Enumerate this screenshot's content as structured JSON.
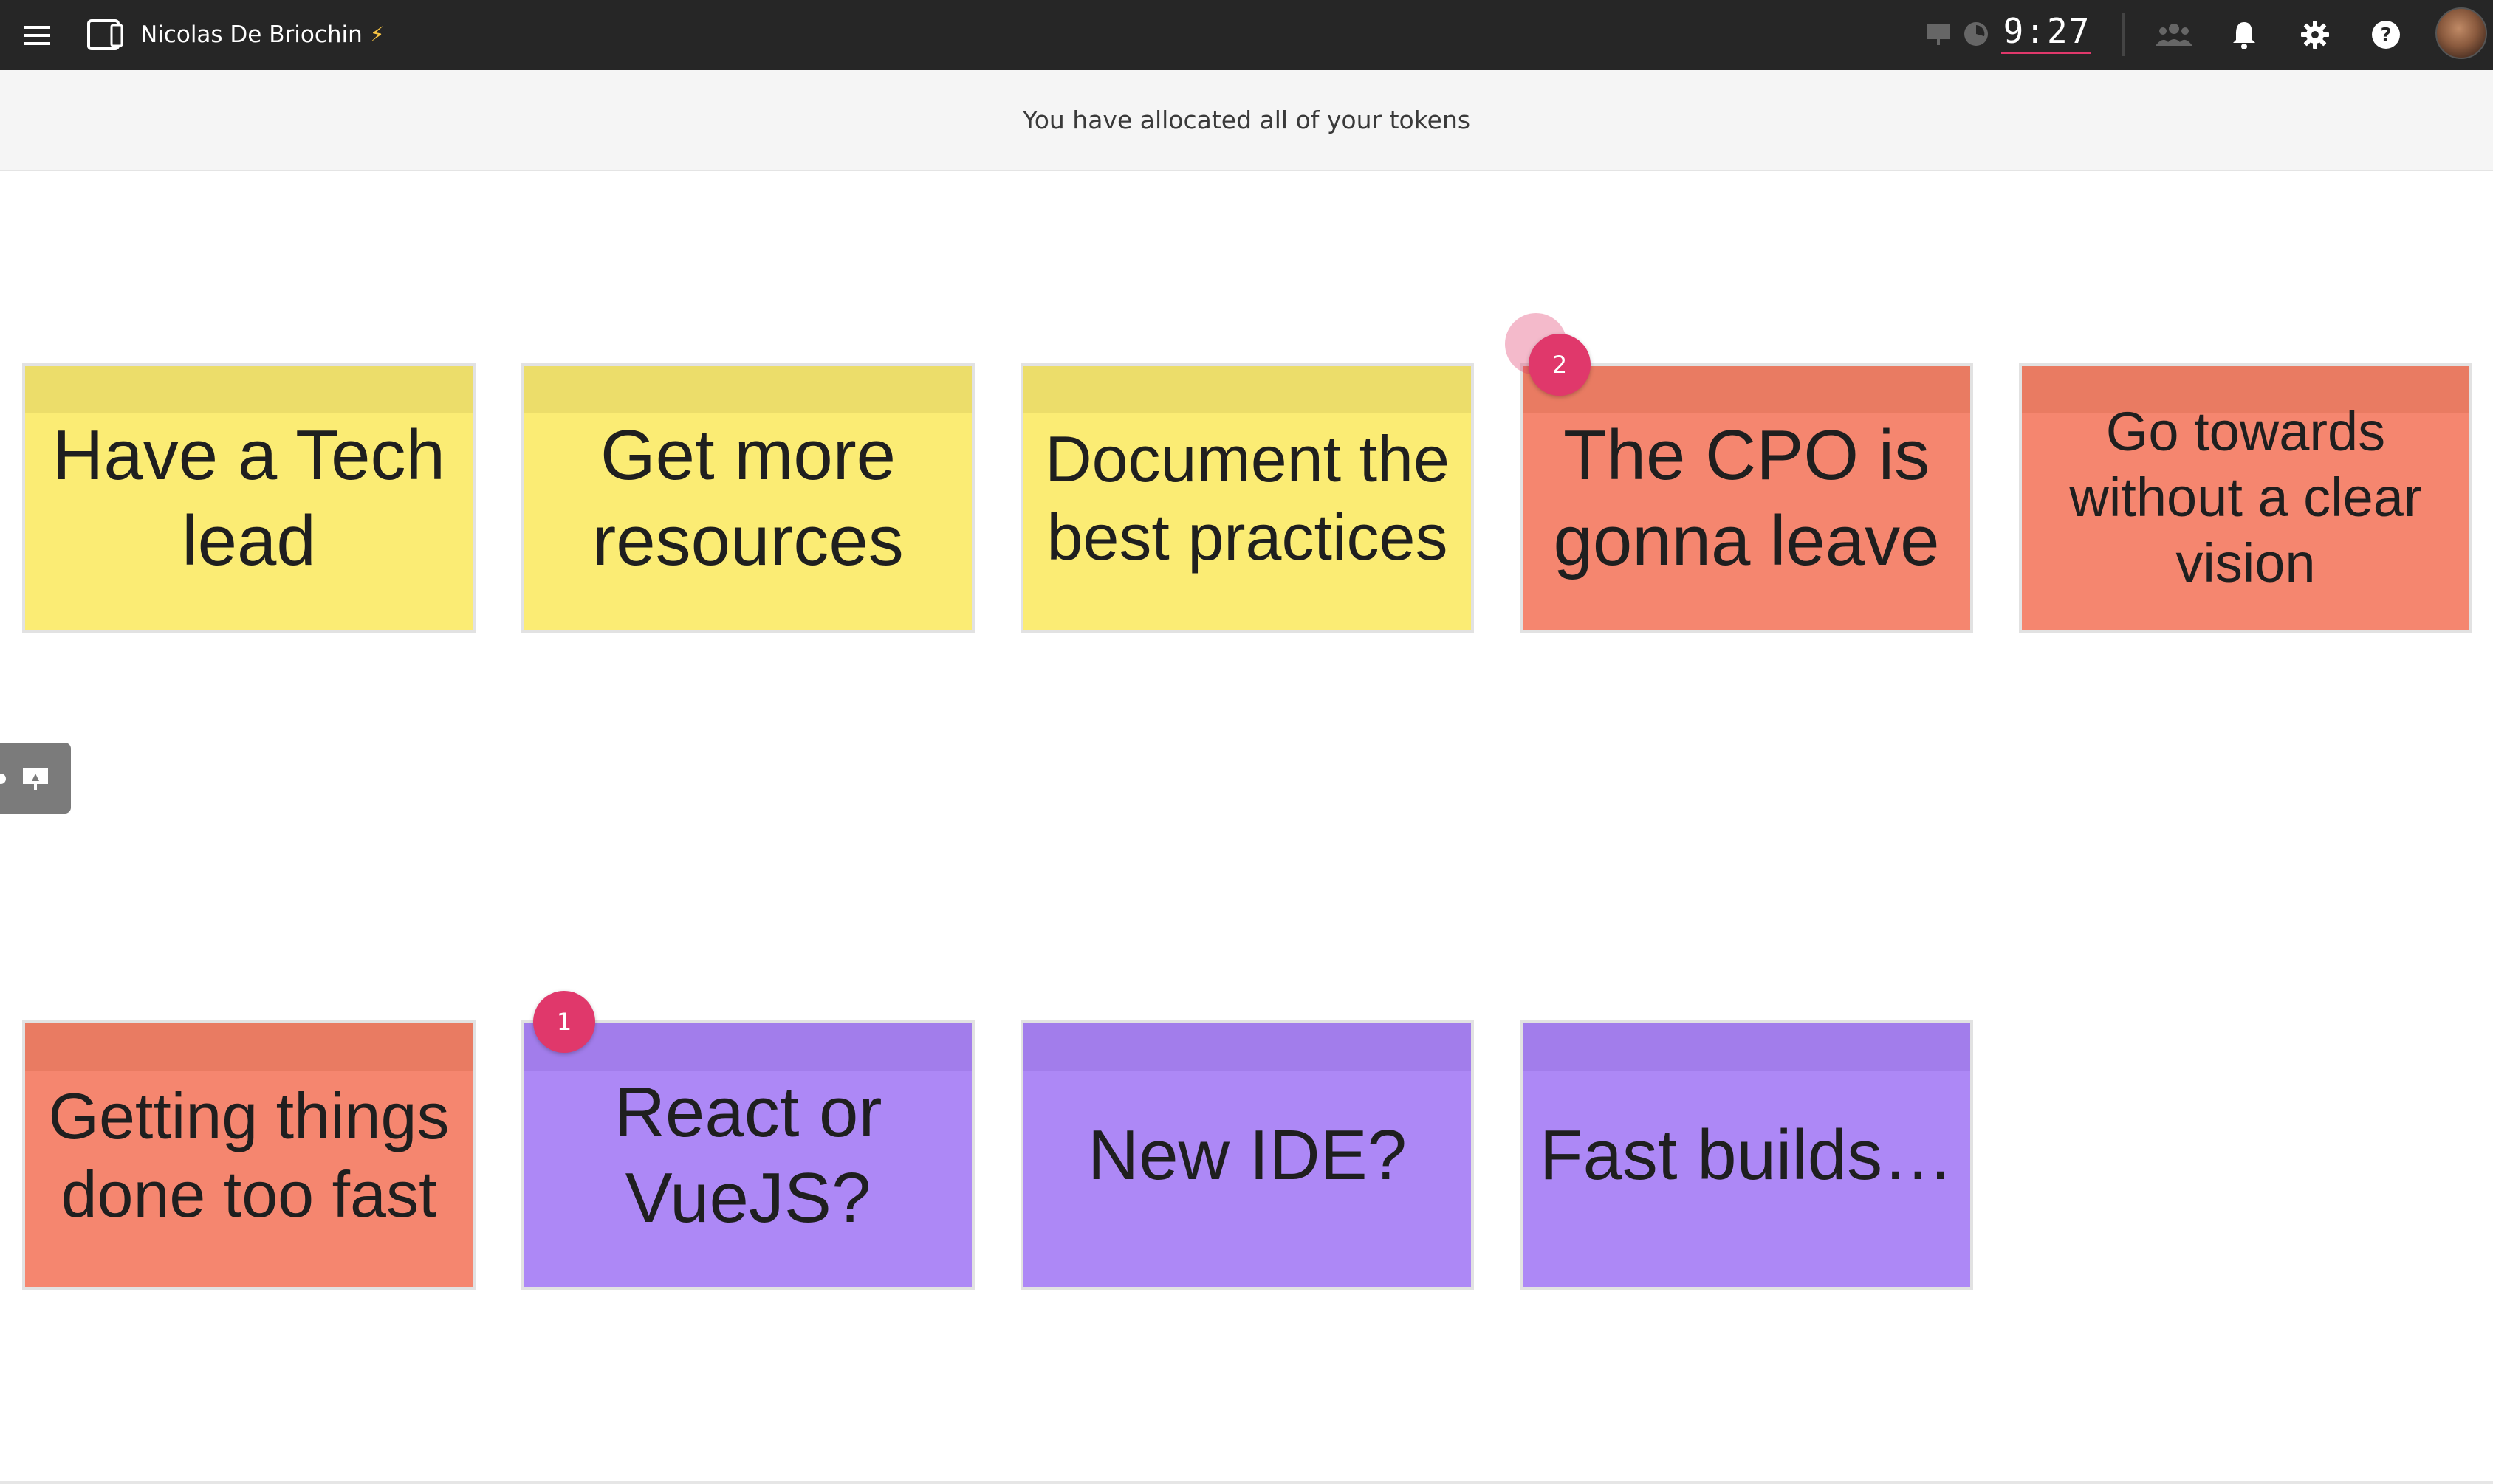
{
  "header": {
    "user_name": "Nicolas De Briochin",
    "bolt_icon": "lightning-bolt",
    "timer": "9:27",
    "icons": [
      "menu-icon",
      "tablet-icon",
      "presenter-icon",
      "clock-icon",
      "participants-icon",
      "bell-icon",
      "gear-icon",
      "help-icon"
    ]
  },
  "banner": {
    "message": "You have allocated all of your tokens"
  },
  "board": {
    "notes": [
      {
        "text": "Have a Tech lead",
        "color": "yellow",
        "votes": null
      },
      {
        "text": "Get more resources",
        "color": "yellow",
        "votes": null
      },
      {
        "text": "Document the best practices",
        "color": "yellow",
        "votes": null
      },
      {
        "text": "The CPO is gonna leave",
        "color": "red",
        "votes": "2"
      },
      {
        "text": "Go towards without a clear vision",
        "color": "red",
        "votes": null
      },
      {
        "text": "Getting things done too fast",
        "color": "red",
        "votes": null
      },
      {
        "text": "React or VueJS?",
        "color": "purple",
        "votes": "1"
      },
      {
        "text": "New IDE?",
        "color": "purple",
        "votes": null
      },
      {
        "text": "Fast builds…",
        "color": "purple",
        "votes": null
      }
    ]
  },
  "colors": {
    "topbar": "#262626",
    "accent": "#e0386b",
    "yellow_note": "#fbec74",
    "red_note": "#f5866f",
    "purple_note": "#ad88f6"
  }
}
